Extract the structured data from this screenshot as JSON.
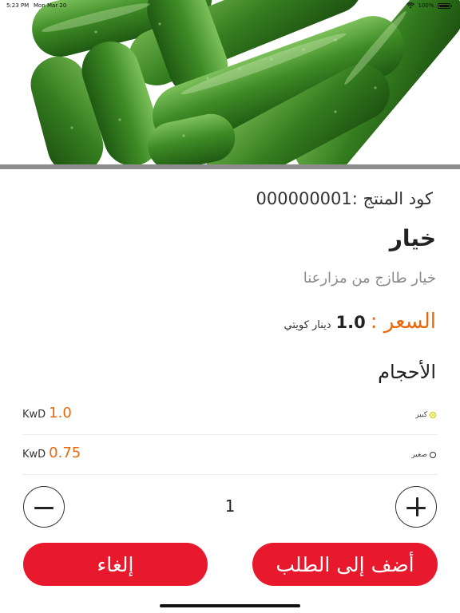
{
  "status_bar": {
    "time": "5:23 PM",
    "date": "Mon Mar 20",
    "battery": "100%"
  },
  "product": {
    "code_label": "كود المنتج :",
    "code_value": "000000001",
    "name": "خيار",
    "description": "خيار طازج من مزارعنا",
    "price_label": "السعر :",
    "price_value": "1.0",
    "price_currency": "دينار كويتي"
  },
  "sizes": {
    "title": "الأحجام",
    "options": [
      {
        "label": "كبير",
        "unit": "KwD",
        "price": "1.0",
        "selected": true
      },
      {
        "label": "صغير",
        "unit": "KwD",
        "price": "0.75",
        "selected": false
      }
    ]
  },
  "quantity": {
    "value": "1"
  },
  "actions": {
    "add_label": "أضف إلى الطلب",
    "cancel_label": "إلغاء"
  },
  "colors": {
    "accent_orange": "#e8680c",
    "button_red": "#e8192c",
    "cucumber_green": "#3f8c26"
  },
  "icons": {
    "plus": "plus-icon",
    "minus": "minus-icon",
    "wifi": "wifi-icon",
    "battery": "battery-icon"
  }
}
